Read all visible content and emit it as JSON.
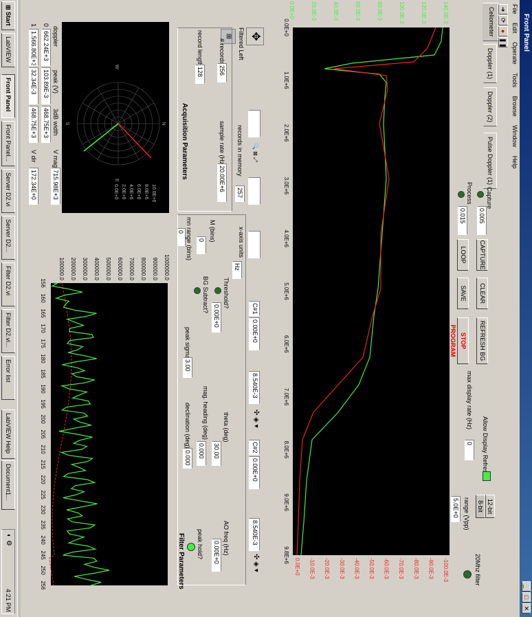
{
  "window": {
    "title": "Front Panel",
    "controls": [
      "_",
      "□",
      "✕"
    ]
  },
  "menu": [
    "File",
    "Edit",
    "Operate",
    "Tools",
    "Browse",
    "Window",
    "Help"
  ],
  "tabs": [
    "Celiometer",
    "Doppler (1)",
    "Doppler (2)",
    "Pulse Doppler (1)"
  ],
  "main_chart": {
    "x_ticks": [
      "0.0E+0",
      "1.0E+6",
      "2.0E+6",
      "3.0E+6",
      "4.0E+6",
      "5.0E+6",
      "6.0E+6",
      "7.0E+6",
      "8.0E+6",
      "9.0E+6",
      "9.8E+6"
    ],
    "left_ticks": [
      "140.0E-3",
      "120.0E-3",
      "100.0E-3",
      "80.0E-3",
      "60.0E-3",
      "40.0E-3",
      "20.0E-3",
      "0.0E+0"
    ],
    "right_ticks": [
      "-100.0E-3",
      "-90.0E-3",
      "-80.0E-3",
      "-70.0E-3",
      "-60.0E-3",
      "-50.0E-3",
      "-40.0E-3",
      "-30.0E-3",
      "-20.0E-3",
      "-10.0E-3",
      "0.0E+0"
    ]
  },
  "controls": {
    "capture_label": "Capture",
    "capture_value": "0.005",
    "capture_btn": "CAPTURE",
    "process_label": "Process",
    "process_value": "0.015",
    "loop_btn": "LOOP",
    "clear_btn": "CLEAR",
    "save_btn": "SAVE",
    "refresh_bg_btn": "REFRESH BG",
    "stop_btn": "STOP PROGRAM",
    "allow_refresh_label": "Allow Display Refresh",
    "max_rate_label": "max display rate (Hz)",
    "max_rate_value": "0",
    "bit12_tab": "12-bit",
    "bit8_tab": "8-bit",
    "range_label": "range (Vpp)",
    "range_value": "5.0E+0",
    "filter20_label": "20Mhz filter"
  },
  "cursors": {
    "c1_label": "C#1",
    "c1_x": "0.00E+0",
    "c1_y": "8.540E-3",
    "c2_label": "C#2",
    "c2_x": "0.00E+0",
    "c2_y": "8.540E-3"
  },
  "filtered_label": "Filtered Left",
  "records_in_memory_label": "records in memory",
  "records_in_memory_value": "257",
  "acquisition": {
    "title": "Acquisition Parameters",
    "records_label": "# records",
    "records_value": "256",
    "record_length_label": "record length",
    "record_length_value": "128",
    "sample_rate_label": "sample rate (Hz)",
    "sample_rate_value": "20.00E+6"
  },
  "filter_params": {
    "title": "Filter Parameters",
    "x_units_label": "x-axis units",
    "x_units_value": "Hz",
    "threshold_label": "Threshold?",
    "bg_subtract_label": "BG Subtract?",
    "theta_label": "theta (deg)",
    "theta_value": "30.00",
    "ao_freq_label": "AO freq (Hz)",
    "ao_freq_value": "0.00E+0",
    "mag_heading_label": "mag. heading (deg)",
    "mag_heading_value": "0.000",
    "peak_hold_label": "peak hold?",
    "m_bins_label": "M (bins)",
    "m_bins_value": "0",
    "mn_range_label": "mn range (bins)",
    "mn_range_value": "0",
    "peak_sigma_label": "peak sigma",
    "peak_sigma_value": "3.00",
    "declination_label": "declination (deg)",
    "declination_value": "0.000"
  },
  "polar": {
    "ring_labels": [
      "10.0E+6",
      "8.0E+6",
      "6.0E+6",
      "4.0E+6",
      "2.0E+6",
      "0.0E+0"
    ],
    "compass": [
      "N",
      "E",
      "S",
      "W"
    ]
  },
  "table": {
    "headers": [
      "doppler",
      "peak (V)",
      "3dB width"
    ],
    "rows": [
      [
        "0",
        "662.24E+3",
        "103.89E-3",
        "468.75E+3"
      ],
      [
        "1",
        "1.566.80E+3",
        "32.34E-3",
        "468.75E+3"
      ]
    ]
  },
  "vmag_label": "V mag",
  "vmag_value": "715.98E+3",
  "vdir_label": "V dir",
  "vdir_value": "172.34E+0",
  "bottom_chart": {
    "y_ticks": [
      "1000000.0",
      "900000.0",
      "800000.0",
      "700000.0",
      "600000.0",
      "500000.0",
      "400000.0",
      "300000.0",
      "200000.0",
      "100000.0"
    ],
    "x_ticks": [
      "156",
      "160",
      "165",
      "170",
      "175",
      "180",
      "185",
      "190",
      "195",
      "200",
      "205",
      "210",
      "215",
      "220",
      "225",
      "230",
      "235",
      "240",
      "245",
      "250",
      "256"
    ]
  },
  "taskbar": {
    "start": "Start",
    "items": [
      "LabVIEW",
      "Front Panel",
      "Front Panel...",
      "Server D2.vi",
      "Server D2...",
      "Filter D2.vi",
      "Filter D2.vi...",
      "Error list",
      "LabVIEW Help",
      "Document1..."
    ],
    "clock": "4:21 PM"
  },
  "colors": {
    "green": "#44ee44",
    "red": "#ee2222",
    "plot_bg": "#000000",
    "title_bar": "#0a246a"
  }
}
